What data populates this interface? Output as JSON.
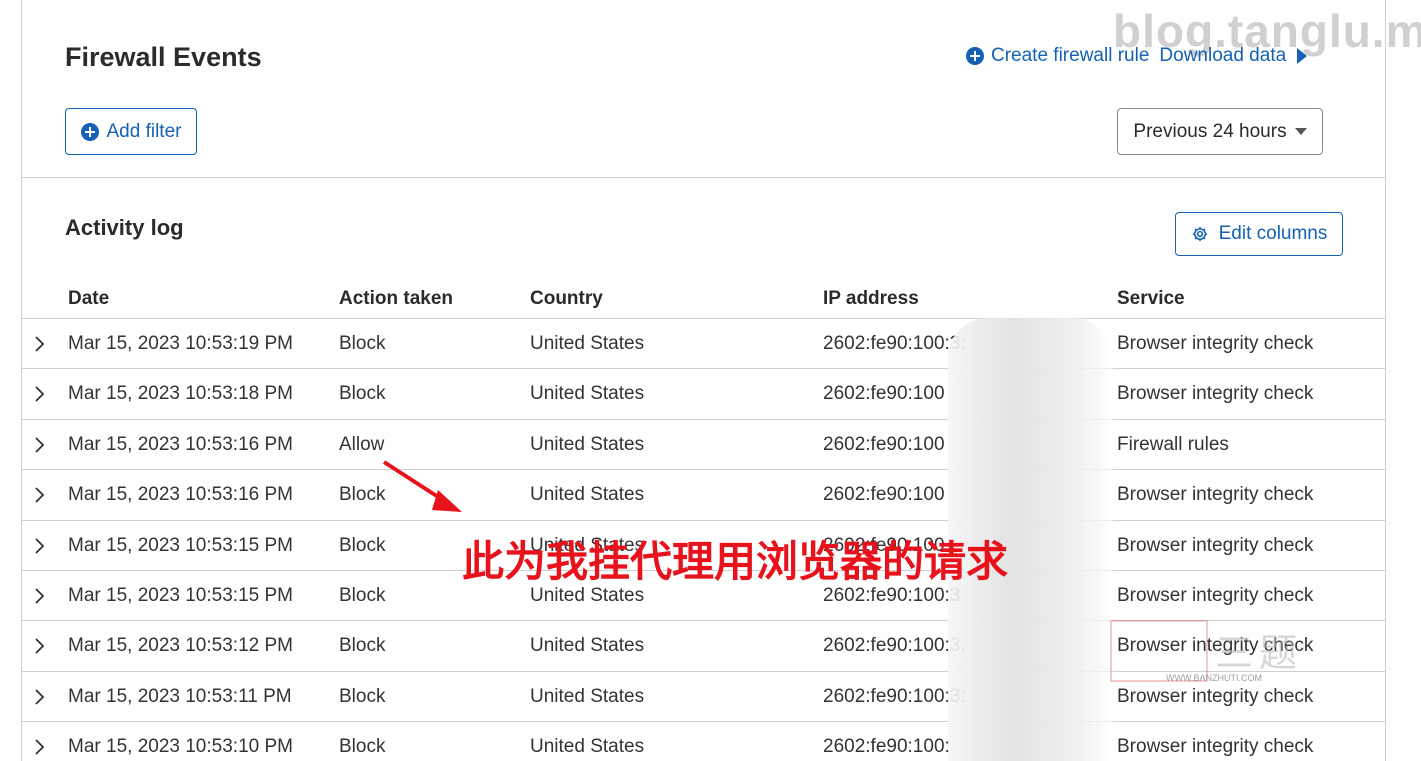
{
  "watermark": "blog.tanglu.me",
  "header": {
    "title": "Firewall Events",
    "create_rule_label": "Create firewall rule",
    "download_label": "Download data",
    "add_filter_label": "Add filter",
    "time_range": "Previous 24 hours"
  },
  "activity": {
    "title": "Activity log",
    "edit_columns_label": "Edit columns",
    "columns": [
      "Date",
      "Action taken",
      "Country",
      "IP address",
      "Service"
    ],
    "rows": [
      {
        "date": "Mar 15, 2023 10:53:19 PM",
        "action": "Block",
        "country": "United States",
        "ip": "2602:fe90:100:3:",
        "service": "Browser integrity check"
      },
      {
        "date": "Mar 15, 2023 10:53:18 PM",
        "action": "Block",
        "country": "United States",
        "ip": "2602:fe90:100",
        "service": "Browser integrity check"
      },
      {
        "date": "Mar 15, 2023 10:53:16 PM",
        "action": "Allow",
        "country": "United States",
        "ip": "2602:fe90:100",
        "service": "Firewall rules"
      },
      {
        "date": "Mar 15, 2023 10:53:16 PM",
        "action": "Block",
        "country": "United States",
        "ip": "2602:fe90:100",
        "service": "Browser integrity check"
      },
      {
        "date": "Mar 15, 2023 10:53:15 PM",
        "action": "Block",
        "country": "United States",
        "ip": "2602:fe90:100",
        "service": "Browser integrity check"
      },
      {
        "date": "Mar 15, 2023 10:53:15 PM",
        "action": "Block",
        "country": "United States",
        "ip": "2602:fe90:100:3",
        "service": "Browser integrity check"
      },
      {
        "date": "Mar 15, 2023 10:53:12 PM",
        "action": "Block",
        "country": "United States",
        "ip": "2602:fe90:100:3.",
        "service": "Browser integrity check"
      },
      {
        "date": "Mar 15, 2023 10:53:11 PM",
        "action": "Block",
        "country": "United States",
        "ip": "2602:fe90:100:3:",
        "service": "Browser integrity check"
      },
      {
        "date": "Mar 15, 2023 10:53:10 PM",
        "action": "Block",
        "country": "United States",
        "ip": "2602:fe90:100:",
        "service": "Browser integrity check"
      }
    ]
  },
  "annotation": "此为我挂代理用浏览器的请求",
  "stamp": {
    "text": "三题",
    "url": "WWW.BANZHUTI.COM"
  },
  "colors": {
    "accent": "#1461b5",
    "annotation": "#e8121c",
    "border": "#cfcfcf"
  }
}
